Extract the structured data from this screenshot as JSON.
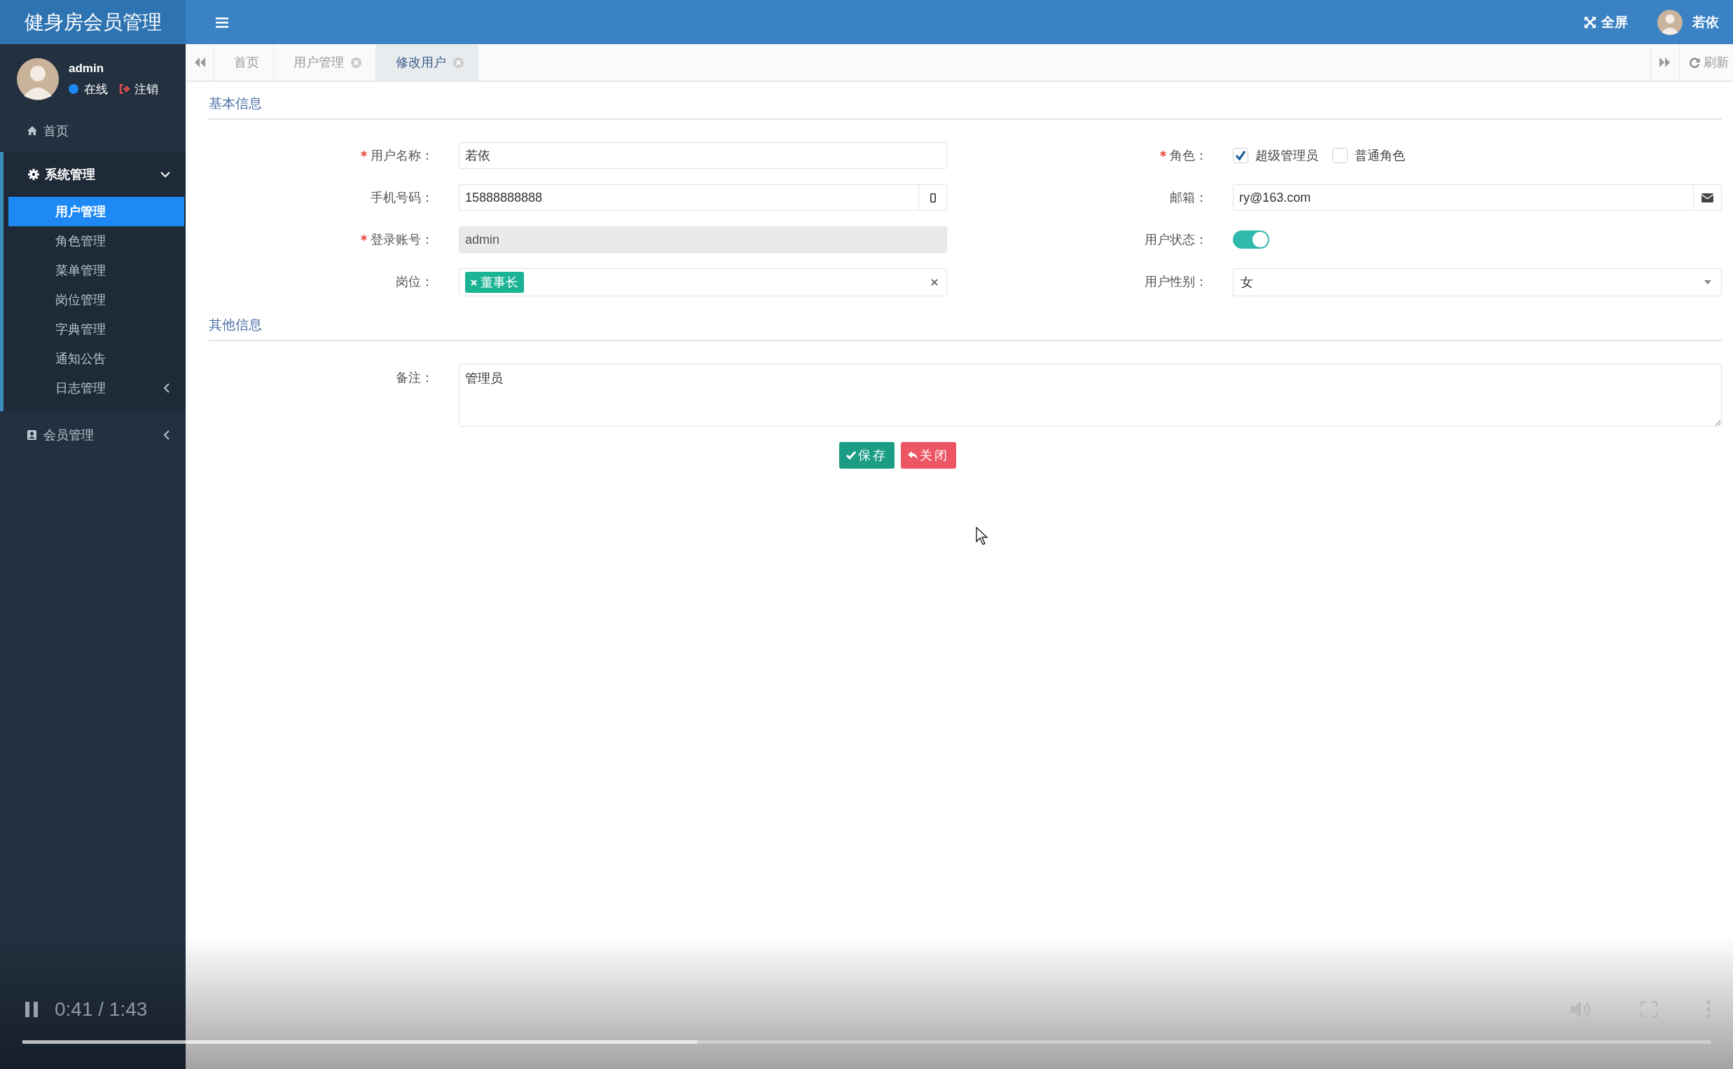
{
  "app": {
    "title": "健身房会员管理"
  },
  "header": {
    "fullscreen": "全屏",
    "user_name": "若依"
  },
  "user_panel": {
    "name": "admin",
    "status": "在线",
    "logout": "注销"
  },
  "sidebar": {
    "items": [
      {
        "label": "首页"
      },
      {
        "label": "系统管理",
        "expanded": true,
        "children": [
          {
            "label": "用户管理",
            "selected": true
          },
          {
            "label": "角色管理",
            "selected": false
          },
          {
            "label": "菜单管理",
            "selected": false
          },
          {
            "label": "岗位管理",
            "selected": false
          },
          {
            "label": "字典管理",
            "selected": false
          },
          {
            "label": "通知公告",
            "selected": false
          },
          {
            "label": "日志管理",
            "selected": false,
            "expanded": false
          }
        ]
      },
      {
        "label": "会员管理",
        "expanded": false
      }
    ]
  },
  "tabs": [
    {
      "label": "首页",
      "closable": false,
      "selected": false
    },
    {
      "label": "用户管理",
      "closable": true,
      "selected": false
    },
    {
      "label": "修改用户",
      "closable": true,
      "selected": true
    }
  ],
  "refresh": "刷新",
  "sections": [
    {
      "title": "基本信息",
      "fields": [
        {
          "kind": "input",
          "label": "用户名称：",
          "required": true,
          "value": "若依"
        },
        {
          "kind": "checkboxes",
          "label": "角色：",
          "required": true,
          "options": [
            {
              "label": "超级管理员",
              "checked": true
            },
            {
              "label": "普通角色",
              "checked": false
            }
          ]
        },
        {
          "kind": "phone",
          "label": "手机号码：",
          "required": false,
          "value": "15888888888"
        },
        {
          "kind": "email",
          "label": "邮箱：",
          "required": false,
          "value": "ry@163.com"
        },
        {
          "kind": "input",
          "label": "登录账号：",
          "required": true,
          "value": "admin",
          "disabled": true
        },
        {
          "kind": "switch",
          "label": "用户状态：",
          "required": false,
          "on": true
        },
        {
          "kind": "tags",
          "label": "岗位：",
          "required": false,
          "tags": [
            "董事长"
          ]
        },
        {
          "kind": "select",
          "label": "用户性别：",
          "required": false,
          "value": "女"
        }
      ]
    },
    {
      "title": "其他信息",
      "fields": [
        {
          "kind": "textarea",
          "label": "备注：",
          "required": false,
          "value": "管理员"
        }
      ]
    }
  ],
  "buttons": [
    {
      "kind": "save",
      "label": "保存"
    },
    {
      "kind": "close",
      "label": "关闭"
    }
  ],
  "video": {
    "time": "0:41 / 1:43",
    "level": 0.4
  }
}
